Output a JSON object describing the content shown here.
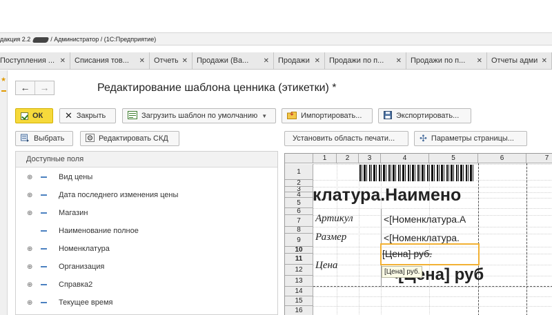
{
  "window": {
    "title_prefix": "дакция 2.2",
    "title_suffix": "/ Администратор /  (1С:Предприятие)"
  },
  "tabs": [
    {
      "label": "Поступления ...",
      "close": "✕"
    },
    {
      "label": "Списания тов...",
      "close": "✕"
    },
    {
      "label": "Отчеты",
      "close": "✕"
    },
    {
      "label": "Продажи (Ва...",
      "close": "✕"
    },
    {
      "label": "Продажи",
      "close": "✕"
    },
    {
      "label": "Продажи по п...",
      "close": "✕"
    },
    {
      "label": "Продажи по п...",
      "close": "✕"
    },
    {
      "label": "Отчеты адми...",
      "close": "✕"
    }
  ],
  "form": {
    "title": "Редактирование шаблона ценника (этикетки) *",
    "nav_back": "←",
    "nav_forward": "→"
  },
  "toolbar": {
    "ok": "ОК",
    "close": "Закрыть",
    "load_default": "Загрузить шаблон по умолчанию",
    "import": "Импортировать...",
    "export": "Экспортировать..."
  },
  "toolbar2": {
    "select": "Выбрать",
    "edit_skd": "Редактировать СКД",
    "set_print_area": "Установить область печати...",
    "page_params": "Параметры страницы..."
  },
  "fields": {
    "header": "Доступные поля",
    "items": [
      {
        "label": "Вид цены",
        "expandable": true
      },
      {
        "label": "Дата последнего изменения цены",
        "expandable": true
      },
      {
        "label": "Магазин",
        "expandable": true
      },
      {
        "label": "Наименование полное",
        "expandable": false
      },
      {
        "label": "Номенклатура",
        "expandable": true
      },
      {
        "label": "Организация",
        "expandable": true
      },
      {
        "label": "Справка2",
        "expandable": true
      },
      {
        "label": "Текущее время",
        "expandable": true
      }
    ]
  },
  "sheet": {
    "columns": [
      "1",
      "2",
      "3",
      "4",
      "5",
      "6",
      "7"
    ],
    "rows": [
      "1",
      "2",
      "3",
      "4",
      "5",
      "6",
      "7",
      "8",
      "9",
      "10",
      "11",
      "12",
      "13",
      "14",
      "15",
      "16"
    ],
    "name_cell": "клатура.Наимено",
    "article_label": "Артикул",
    "article_value": "<[Номенклатура.А",
    "size_label": "Размер",
    "size_value": "<[Номенклатура.",
    "price_label": "Цена",
    "price_small": "[Цена] руб.",
    "price_big": "<[Цена] руб",
    "tooltip": "[Цена] руб."
  }
}
